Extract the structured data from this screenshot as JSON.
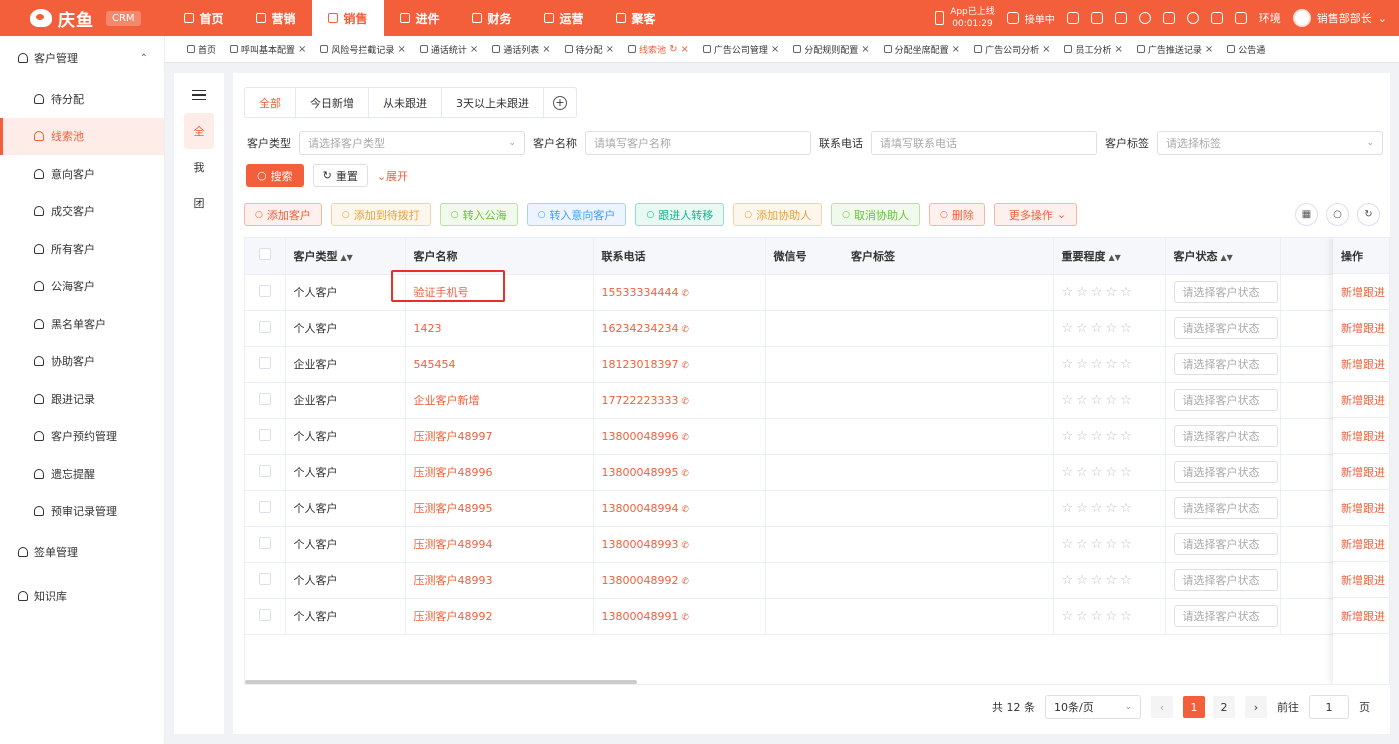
{
  "brand": {
    "name": "庆鱼",
    "badge": "CRM"
  },
  "nav": [
    {
      "label": "首页",
      "active": false
    },
    {
      "label": "营销",
      "active": false
    },
    {
      "label": "销售",
      "active": true
    },
    {
      "label": "进件",
      "active": false
    },
    {
      "label": "财务",
      "active": false
    },
    {
      "label": "运营",
      "active": false
    },
    {
      "label": "聚客",
      "active": false
    }
  ],
  "header": {
    "app_line1": "App已上线",
    "app_line2": "00:01:29",
    "dispatch": "接单中",
    "env": "环境",
    "user": "销售部部长"
  },
  "tabs": [
    {
      "label": "首页",
      "active": false,
      "close": false
    },
    {
      "label": "呼叫基本配置",
      "active": false,
      "close": true
    },
    {
      "label": "风险号拦截记录",
      "active": false,
      "close": true
    },
    {
      "label": "通话统计",
      "active": false,
      "close": true
    },
    {
      "label": "通话列表",
      "active": false,
      "close": true
    },
    {
      "label": "待分配",
      "active": false,
      "close": true
    },
    {
      "label": "线索池",
      "active": true,
      "close": true
    },
    {
      "label": "广告公司管理",
      "active": false,
      "close": true
    },
    {
      "label": "分配规则配置",
      "active": false,
      "close": true
    },
    {
      "label": "分配坐席配置",
      "active": false,
      "close": true
    },
    {
      "label": "广告公司分析",
      "active": false,
      "close": true
    },
    {
      "label": "员工分析",
      "active": false,
      "close": true
    },
    {
      "label": "广告推送记录",
      "active": false,
      "close": true
    },
    {
      "label": "公告通",
      "active": false,
      "close": false
    }
  ],
  "sidebar": {
    "group1": "客户管理",
    "items": [
      {
        "label": "待分配",
        "active": false
      },
      {
        "label": "线索池",
        "active": true
      },
      {
        "label": "意向客户",
        "active": false
      },
      {
        "label": "成交客户",
        "active": false
      },
      {
        "label": "所有客户",
        "active": false
      },
      {
        "label": "公海客户",
        "active": false
      },
      {
        "label": "黑名单客户",
        "active": false
      },
      {
        "label": "协助客户",
        "active": false
      },
      {
        "label": "跟进记录",
        "active": false
      },
      {
        "label": "客户预约管理",
        "active": false
      },
      {
        "label": "遗忘提醒",
        "active": false
      },
      {
        "label": "预审记录管理",
        "active": false
      }
    ],
    "group2": "签单管理",
    "group3": "知识库"
  },
  "rail": {
    "all": "全",
    "me": "我",
    "team": "团"
  },
  "subtabs": [
    "全部",
    "今日新增",
    "从未跟进",
    "3天以上未跟进"
  ],
  "filters": {
    "type_label": "客户类型",
    "type_placeholder": "请选择客户类型",
    "name_label": "客户名称",
    "name_placeholder": "请填写客户名称",
    "phone_label": "联系电话",
    "phone_placeholder": "请填写联系电话",
    "tag_label": "客户标签",
    "tag_placeholder": "请选择标签"
  },
  "search": {
    "search": "搜索",
    "reset": "重置",
    "expand": "展开"
  },
  "actions": [
    {
      "label": "添加客户",
      "color": "#f25f3a",
      "bg": "#fef0ec"
    },
    {
      "label": "添加到待拨打",
      "color": "#e6a23c",
      "bg": "#fdf6ec"
    },
    {
      "label": "转入公海",
      "color": "#67c23a",
      "bg": "#f0f9eb"
    },
    {
      "label": "转入意向客户",
      "color": "#409eff",
      "bg": "#ecf5ff"
    },
    {
      "label": "跟进人转移",
      "color": "#13b88a",
      "bg": "#e8f8f3"
    },
    {
      "label": "添加协助人",
      "color": "#e6a23c",
      "bg": "#fdf6ec"
    },
    {
      "label": "取消协助人",
      "color": "#67c23a",
      "bg": "#f0f9eb"
    },
    {
      "label": "删除",
      "color": "#f25f3a",
      "bg": "#fef0ec"
    },
    {
      "label": "更多操作",
      "color": "#f25f3a",
      "bg": "#fef0ec"
    }
  ],
  "table": {
    "headers": {
      "type": "客户类型",
      "name": "客户名称",
      "phone": "联系电话",
      "wechat": "微信号",
      "tag": "客户标签",
      "importance": "重要程度",
      "status": "客户状态",
      "op": "操作"
    },
    "status_placeholder": "请选择客户状态",
    "op_label": "新增跟进",
    "rows": [
      {
        "type": "个人客户",
        "name": "验证手机号",
        "phone": "15533334444"
      },
      {
        "type": "个人客户",
        "name": "1423",
        "phone": "16234234234"
      },
      {
        "type": "企业客户",
        "name": "545454",
        "phone": "18123018397"
      },
      {
        "type": "企业客户",
        "name": "企业客户新增",
        "phone": "17722223333"
      },
      {
        "type": "个人客户",
        "name": "压测客户48997",
        "phone": "13800048996"
      },
      {
        "type": "个人客户",
        "name": "压测客户48996",
        "phone": "13800048995"
      },
      {
        "type": "个人客户",
        "name": "压测客户48995",
        "phone": "13800048994"
      },
      {
        "type": "个人客户",
        "name": "压测客户48994",
        "phone": "13800048993"
      },
      {
        "type": "个人客户",
        "name": "压测客户48993",
        "phone": "13800048992"
      },
      {
        "type": "个人客户",
        "name": "压测客户48992",
        "phone": "13800048991"
      }
    ]
  },
  "pager": {
    "total": "共 12 条",
    "size": "10条/页",
    "pages": [
      "1",
      "2"
    ],
    "current": "1",
    "goto": "前往",
    "goto_value": "1",
    "page_unit": "页"
  }
}
